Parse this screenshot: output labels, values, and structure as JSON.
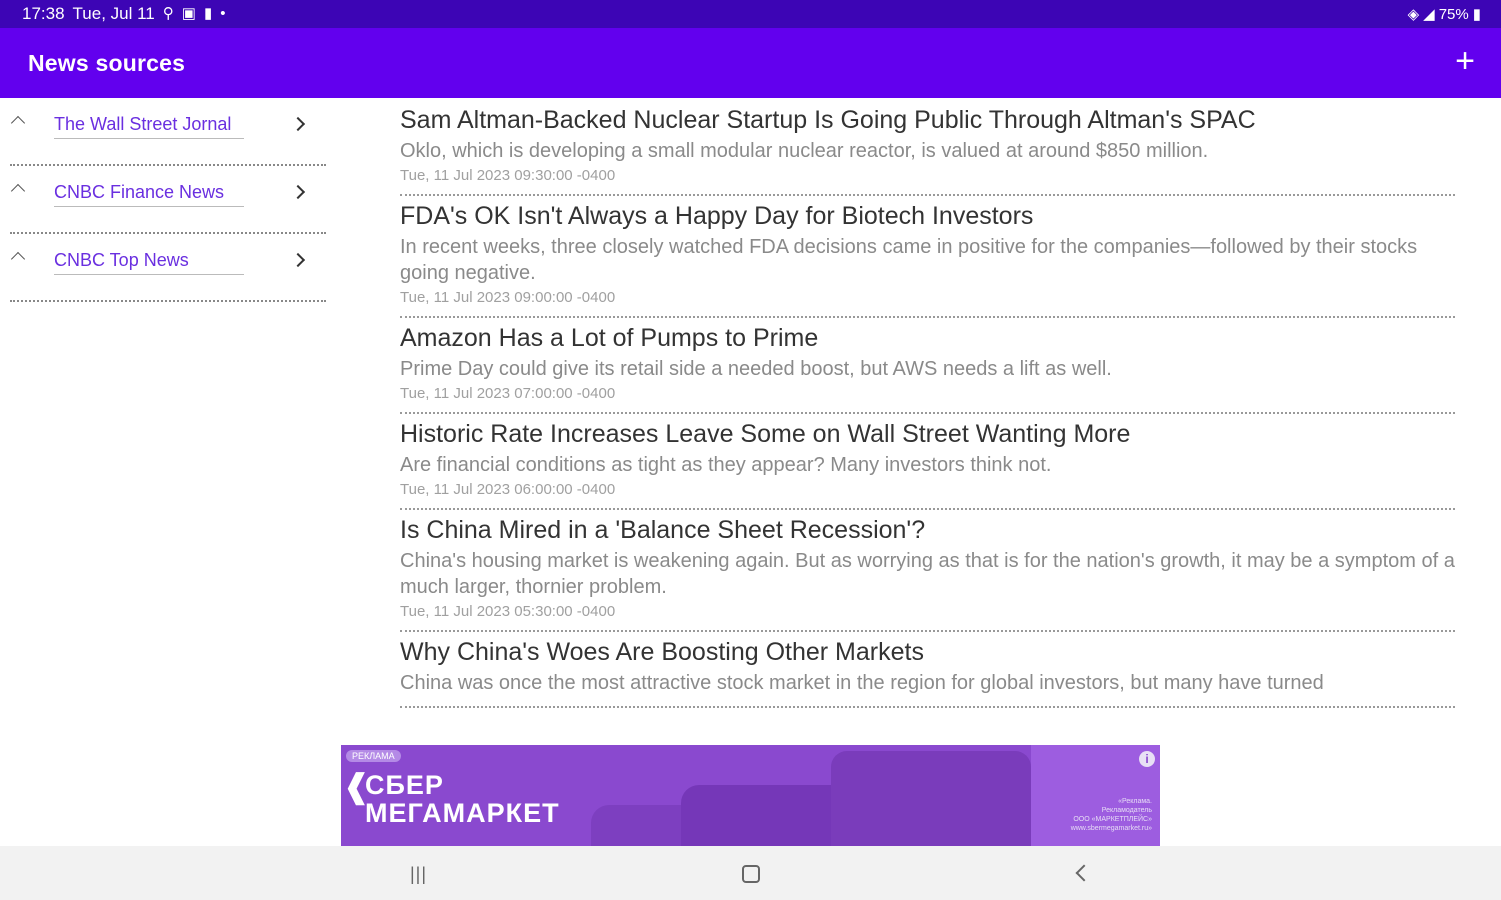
{
  "status_bar": {
    "time": "17:38",
    "date": "Tue, Jul 11",
    "battery": "75%",
    "icons": [
      "search-icon",
      "gallery-icon",
      "sd-card-icon",
      "dot-icon",
      "wifi-icon",
      "signal-icon",
      "battery-icon"
    ]
  },
  "app_bar": {
    "title": "News sources",
    "add_icon": "plus-icon"
  },
  "sources": [
    {
      "label": "The Wall Street Jornal"
    },
    {
      "label": "CNBC Finance News"
    },
    {
      "label": "CNBC Top News"
    }
  ],
  "articles": [
    {
      "title": "Sam Altman-Backed Nuclear Startup Is Going Public Through Altman's SPAC",
      "summary": "Oklo, which is developing a small modular nuclear reactor, is valued at around $850 million.",
      "date": "Tue, 11 Jul 2023 09:30:00 -0400"
    },
    {
      "title": "FDA's OK Isn't Always a Happy Day for Biotech Investors",
      "summary": "In recent weeks, three closely watched FDA decisions came in positive for the companies—followed by their stocks going negative.",
      "date": "Tue, 11 Jul 2023 09:00:00 -0400"
    },
    {
      "title": "Amazon Has a Lot of Pumps to Prime",
      "summary": "Prime Day could give its retail side a needed boost, but AWS needs a lift as well.",
      "date": "Tue, 11 Jul 2023 07:00:00 -0400"
    },
    {
      "title": "Historic Rate Increases Leave Some on Wall Street Wanting More",
      "summary": "Are financial conditions as tight as they appear? Many investors think not.",
      "date": "Tue, 11 Jul 2023 06:00:00 -0400"
    },
    {
      "title": "Is China Mired in a 'Balance Sheet Recession'?",
      "summary": "China's housing market is weakening again. But as worrying as that is for the nation's growth, it may be a symptom of a much larger, thornier problem.",
      "date": "Tue, 11 Jul 2023 05:30:00 -0400"
    },
    {
      "title": "Why China's Woes Are Boosting Other Markets",
      "summary": "China was once the most attractive stock market in the region for global investors, but many have turned",
      "date": ""
    }
  ],
  "ad": {
    "tag": "РЕКЛАМА",
    "brand_line1": "СБЕР",
    "brand_line2": "МЕГАМАРКЕТ",
    "info": "i",
    "legal_line1": "«Реклама.",
    "legal_line2": "Рекламодатель",
    "legal_line3": "ООО «МАРКЕТПЛЕЙС»",
    "legal_line4": "www.sbermegamarket.ru»",
    "accent_color": "#8a49cf"
  },
  "nav_bar": {
    "recent_glyph": "|||",
    "icons": [
      "recent-apps-icon",
      "home-icon",
      "back-icon"
    ]
  },
  "colors": {
    "status_bar": "#3d05b5",
    "app_bar": "#6200ee",
    "source_link": "#6a2fe0"
  }
}
